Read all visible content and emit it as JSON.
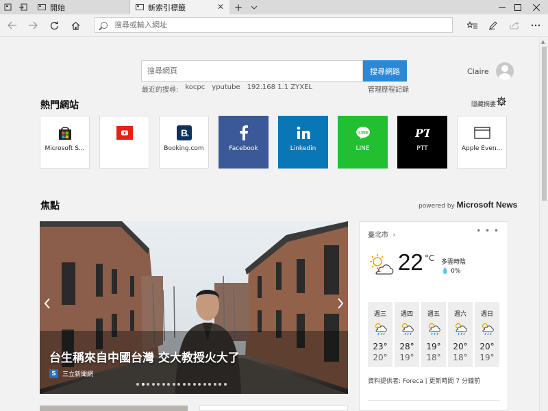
{
  "tabs": {
    "inactive": {
      "title": "開始"
    },
    "active": {
      "title": "新索引標籤"
    }
  },
  "navbar": {
    "address_placeholder": "搜尋或輸入網址"
  },
  "search": {
    "placeholder": "搜尋網頁",
    "button_label": "搜尋網路",
    "recent_label": "最近的搜尋:",
    "recent": [
      "kocpc",
      "yputube",
      "192.168 1.1 ZYXEL"
    ],
    "history_label": "管理歷程記錄"
  },
  "user": {
    "name": "Claire"
  },
  "top_sites": {
    "title": "熱門網站",
    "hide_feed_label": "隱藏摘要",
    "sites": [
      {
        "label": "Microsoft S...",
        "icon": "microsoft-store-icon",
        "bg": "#ffffff"
      },
      {
        "label": "",
        "icon": "youtube-icon",
        "bg": "#ffffff"
      },
      {
        "label": "Booking.com",
        "icon": "booking-icon",
        "bg": "#ffffff"
      },
      {
        "label": "Facebook",
        "icon": "facebook-icon",
        "bg": "#3b5998"
      },
      {
        "label": "Linkedin",
        "icon": "linkedin-icon",
        "bg": "#0a77b5"
      },
      {
        "label": "LINE",
        "icon": "line-icon",
        "bg": "#21c031"
      },
      {
        "label": "PTT",
        "icon": "ptt-icon",
        "bg": "#000000"
      },
      {
        "label": "Apple Even...",
        "icon": "apple-events-icon",
        "bg": "#ffffff"
      }
    ]
  },
  "news": {
    "title": "焦點",
    "powered_prefix": "powered by",
    "powered_brand": "Microsoft News",
    "hero": {
      "headline": "台生稱來自中國台灣 交大教授火大了",
      "source": "三立新聞網",
      "source_logo_letter": "S",
      "slides_total": 18,
      "slide_active": 2
    }
  },
  "weather": {
    "city": "臺北市",
    "temp": "22",
    "unit": "°C",
    "condition": "多雲時陰",
    "precip": "0%",
    "more": "• • •",
    "forecast": [
      {
        "day": "週三",
        "hi": "23°",
        "lo": "20°"
      },
      {
        "day": "週四",
        "hi": "28°",
        "lo": "19°"
      },
      {
        "day": "週五",
        "hi": "19°",
        "lo": "18°"
      },
      {
        "day": "週六",
        "hi": "20°",
        "lo": "18°"
      },
      {
        "day": "週日",
        "hi": "20°",
        "lo": "19°"
      }
    ],
    "credit": "資料提供者: Foreca | 更新時間 7 分鐘前"
  },
  "colors": {
    "accent": "#2b88d8",
    "facebook": "#3b5998",
    "linkedin": "#0a77b5",
    "line": "#21c031",
    "ptt": "#000000"
  }
}
